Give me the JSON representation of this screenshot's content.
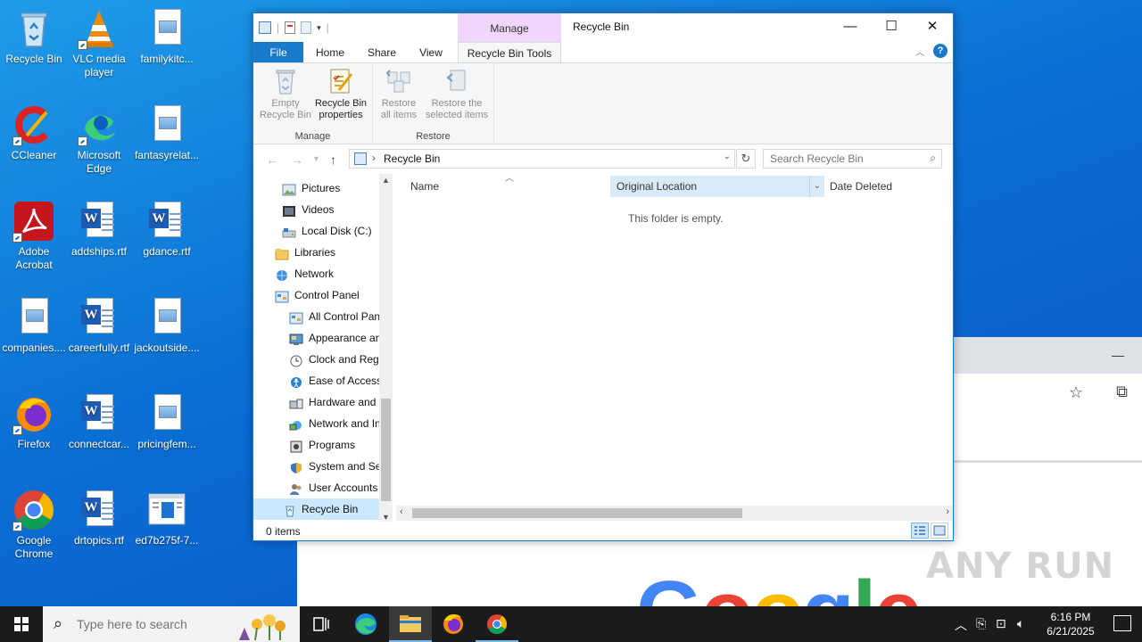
{
  "desktop": {
    "icons": [
      {
        "label": "Recycle Bin",
        "icon": "recycle-bin-icon"
      },
      {
        "label": "VLC media player",
        "icon": "vlc-icon"
      },
      {
        "label": "familykitc...",
        "icon": "image-file-icon"
      },
      {
        "label": "CCleaner",
        "icon": "ccleaner-icon"
      },
      {
        "label": "Microsoft Edge",
        "icon": "edge-icon"
      },
      {
        "label": "fantasyrelat...",
        "icon": "image-file-icon"
      },
      {
        "label": "Adobe Acrobat",
        "icon": "acrobat-icon"
      },
      {
        "label": "addships.rtf",
        "icon": "word-doc-icon"
      },
      {
        "label": "gdance.rtf",
        "icon": "word-doc-icon"
      },
      {
        "label": "companies....",
        "icon": "image-file-icon"
      },
      {
        "label": "careerfully.rtf",
        "icon": "word-doc-icon"
      },
      {
        "label": "jackoutside....",
        "icon": "image-file-icon"
      },
      {
        "label": "Firefox",
        "icon": "firefox-icon"
      },
      {
        "label": "connectcar...",
        "icon": "word-doc-icon"
      },
      {
        "label": "pricingfem...",
        "icon": "image-file-icon"
      },
      {
        "label": "Google Chrome",
        "icon": "chrome-icon"
      },
      {
        "label": "drtopics.rtf",
        "icon": "word-doc-icon"
      },
      {
        "label": "ed7b275f-7...",
        "icon": "exe-file-icon"
      }
    ]
  },
  "background_browser": {
    "logo_text": "Google"
  },
  "watermark": "ANY RUN",
  "explorer": {
    "title": "Recycle Bin",
    "context_tab_group": "Manage",
    "tabs": {
      "file": "File",
      "home": "Home",
      "share": "Share",
      "view": "View",
      "tools": "Recycle Bin Tools"
    },
    "ribbon": {
      "manage_group": "Manage",
      "restore_group": "Restore",
      "empty_bin": [
        "Empty",
        "Recycle Bin"
      ],
      "properties": [
        "Recycle Bin",
        "properties"
      ],
      "restore_all": [
        "Restore",
        "all items"
      ],
      "restore_selected": [
        "Restore the",
        "selected items"
      ]
    },
    "address": {
      "path": "Recycle Bin",
      "search_placeholder": "Search Recycle Bin"
    },
    "nav_items": [
      {
        "label": "Pictures",
        "indent": 2,
        "icon": "pictures-icon"
      },
      {
        "label": "Videos",
        "indent": 2,
        "icon": "videos-icon"
      },
      {
        "label": "Local Disk (C:)",
        "indent": 2,
        "icon": "disk-icon"
      },
      {
        "label": "Libraries",
        "indent": 1,
        "icon": "libraries-icon"
      },
      {
        "label": "Network",
        "indent": 1,
        "icon": "network-icon"
      },
      {
        "label": "Control Panel",
        "indent": 1,
        "icon": "control-panel-icon"
      },
      {
        "label": "All Control Panel Items",
        "indent": 2,
        "icon": "control-panel-icon"
      },
      {
        "label": "Appearance and Personalization",
        "indent": 2,
        "icon": "appearance-icon"
      },
      {
        "label": "Clock and Region",
        "indent": 2,
        "icon": "clock-icon"
      },
      {
        "label": "Ease of Access",
        "indent": 2,
        "icon": "ease-of-access-icon"
      },
      {
        "label": "Hardware and Sound",
        "indent": 2,
        "icon": "hardware-icon"
      },
      {
        "label": "Network and Internet",
        "indent": 2,
        "icon": "network-internet-icon"
      },
      {
        "label": "Programs",
        "indent": 2,
        "icon": "programs-icon"
      },
      {
        "label": "System and Security",
        "indent": 2,
        "icon": "security-icon"
      },
      {
        "label": "User Accounts",
        "indent": 2,
        "icon": "user-accounts-icon"
      },
      {
        "label": "Recycle Bin",
        "indent": 1,
        "icon": "recycle-bin-icon",
        "selected": true
      }
    ],
    "columns": {
      "name": "Name",
      "original_location": "Original Location",
      "date_deleted": "Date Deleted"
    },
    "empty_message": "This folder is empty.",
    "status": "0 items"
  },
  "taskbar": {
    "search_placeholder": "Type here to search",
    "time": "6:16 PM",
    "date": "6/21/2025"
  },
  "colors": {
    "accent": "#1979ca",
    "manage_context": "#f1d6fb",
    "taskbar": "#1b1b1b",
    "desktop": "#0a6fd3"
  }
}
